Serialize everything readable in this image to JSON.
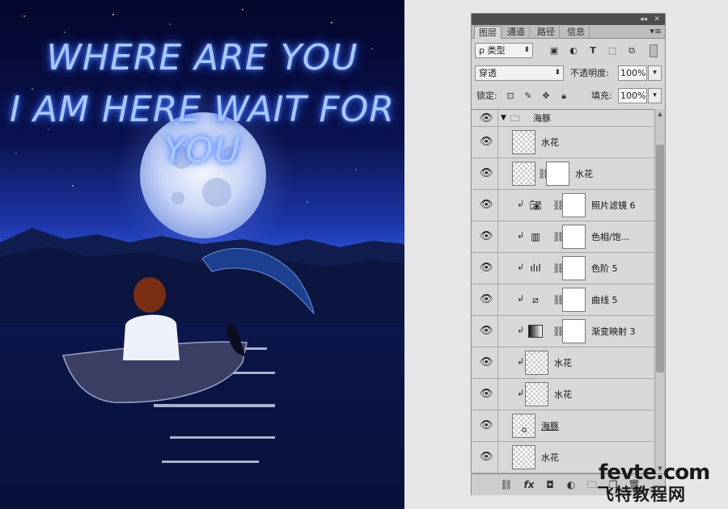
{
  "artwork": {
    "line1": "WHERE ARE YOU",
    "line2": "I AM HERE WAIT FOR YOU"
  },
  "panel": {
    "tabs": [
      {
        "label": "图层",
        "active": true
      },
      {
        "label": "通道",
        "active": false
      },
      {
        "label": "路径",
        "active": false
      },
      {
        "label": "信息",
        "active": false
      }
    ],
    "filter": {
      "label": "ρ 类型"
    },
    "blend_mode": "穿透",
    "opacity_label": "不透明度:",
    "opacity_value": "100%",
    "lock_label": "锁定:",
    "fill_label": "填充:",
    "fill_value": "100%",
    "layers": [
      {
        "name": "海豚",
        "type": "group"
      },
      {
        "name": "水花",
        "type": "pixel"
      },
      {
        "name": "水花",
        "type": "masked"
      },
      {
        "name": "照片滤镜 6",
        "type": "adjustment",
        "icon": "camera-filter-icon"
      },
      {
        "name": "色相/饱...",
        "type": "adjustment",
        "icon": "hue-saturation-icon"
      },
      {
        "name": "色阶 5",
        "type": "adjustment",
        "icon": "levels-icon"
      },
      {
        "name": "曲线 5",
        "type": "adjustment",
        "icon": "curves-icon"
      },
      {
        "name": "渐变映射 3",
        "type": "adjustment",
        "icon": "gradient-map-icon"
      },
      {
        "name": "水花",
        "type": "clipped"
      },
      {
        "name": "水花",
        "type": "clipped"
      },
      {
        "name": "海豚",
        "type": "smart"
      },
      {
        "name": "水花",
        "type": "pixel"
      }
    ]
  },
  "watermark": {
    "line1": "fevte.com",
    "line2": "飞特教程网"
  }
}
